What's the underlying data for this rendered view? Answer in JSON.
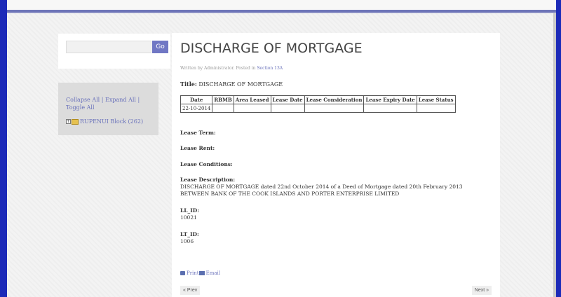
{
  "search": {
    "value": "",
    "go_label": "Go"
  },
  "tree": {
    "collapse_all": "Collapse All",
    "expand_all": "Expand All",
    "toggle_all": "Toggle All",
    "sep": "|",
    "node_label": "RUPENUI Block (262)"
  },
  "article": {
    "title": "DISCHARGE OF MORTGAGE",
    "meta_prefix": "Written by Administrator. Posted in ",
    "meta_link": "Section 13A",
    "title_label": "Title:",
    "title_value": "DISCHARGE OF MORTGAGE",
    "table": {
      "headers": [
        "Date",
        "RBMB",
        "Area Leased",
        "Lease Date",
        "Lease Consideration",
        "Lease Expiry Date",
        "Lease Status"
      ],
      "row": [
        "22-10-2014",
        "",
        "",
        "",
        "",
        "",
        ""
      ]
    },
    "lease_term_label": "Lease Term:",
    "lease_rent_label": "Lease Rent:",
    "lease_conditions_label": "Lease Conditions:",
    "lease_description_label": "Lease Description:",
    "lease_description": "DISCHARGE OF MORTGAGE dated 22nd October 2014 of a Deed of Mortgage dated 20th February 2013 BETWEEN BANK OF THE COOK ISLANDS AND PORTER ENTERPRISE LIMITED",
    "ll_id_label": "LL_ID:",
    "ll_id": "10021",
    "lt_id_label": "LT_ID:",
    "lt_id": "1006",
    "print_label": "Print",
    "email_label": "Email",
    "prev_label": "« Prev",
    "next_label": "Next »"
  }
}
